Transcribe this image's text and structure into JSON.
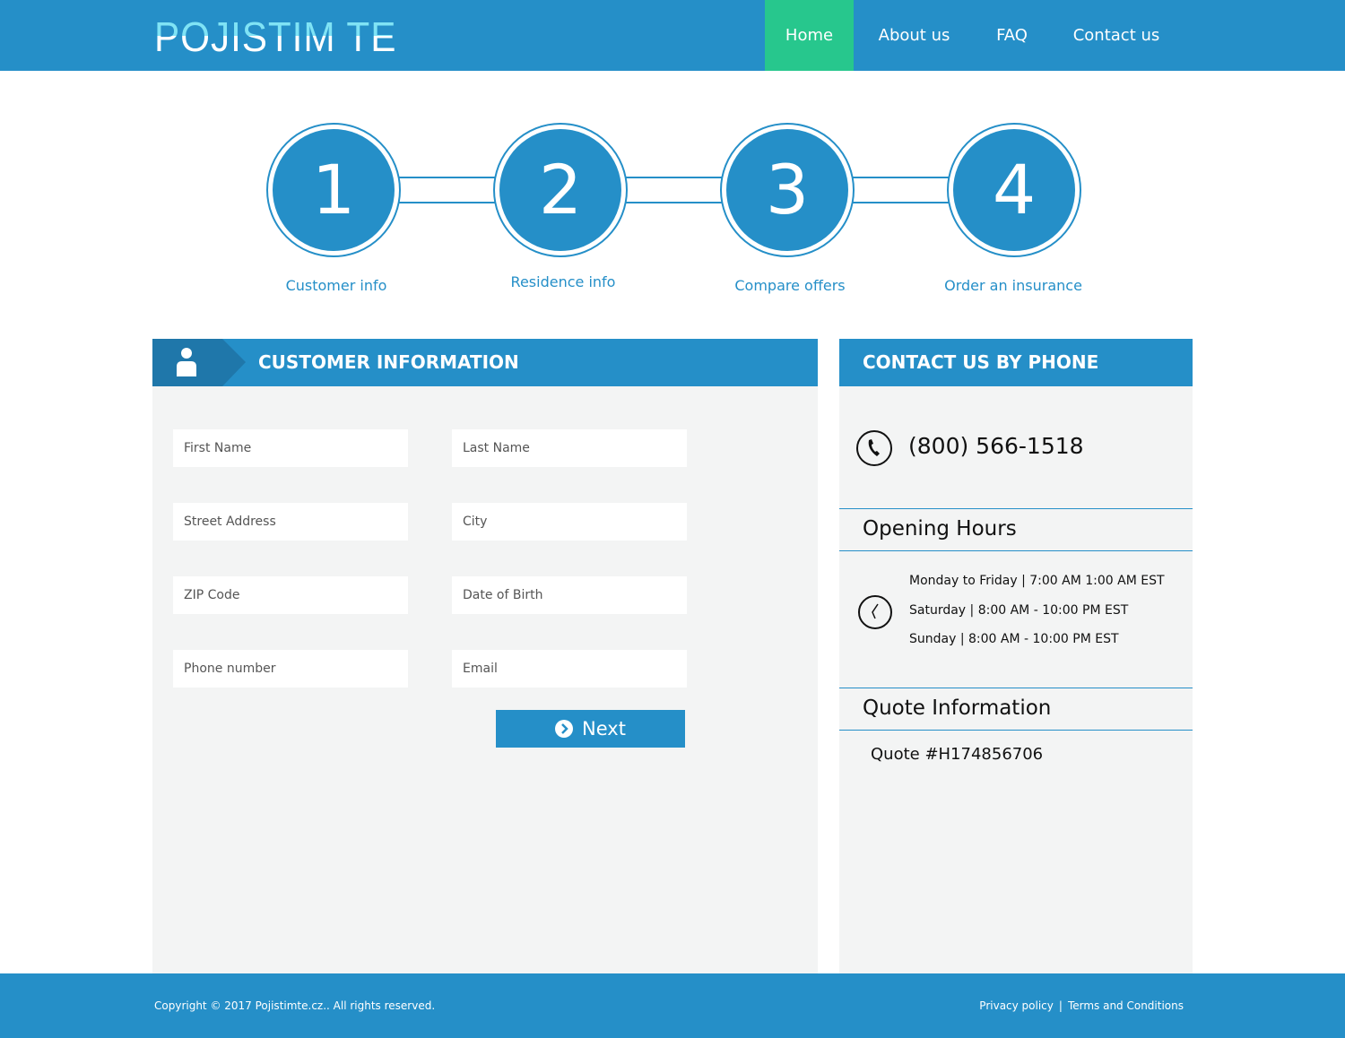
{
  "header": {
    "logo": "POJISTIM TE",
    "nav": [
      "Home",
      "About us",
      "FAQ",
      "Contact us"
    ]
  },
  "steps": [
    {
      "num": "1",
      "label": "Customer info"
    },
    {
      "num": "2",
      "label": "Residence info"
    },
    {
      "num": "3",
      "label": "Compare offers"
    },
    {
      "num": "4",
      "label": "Order an insurance"
    }
  ],
  "form": {
    "title": "CUSTOMER INFORMATION",
    "fields": [
      "First Name",
      "Last Name",
      "Street Address",
      "City",
      "ZIP Code",
      "Date of Birth",
      "Phone number",
      "Email"
    ],
    "next": "Next"
  },
  "contact": {
    "title": "CONTACT US BY PHONE",
    "phone": "(800) 566-1518",
    "hours_title": "Opening Hours",
    "hours": [
      "Monday to Friday | 7:00 AM 1:00 AM EST",
      "Saturday | 8:00 AM - 10:00 PM EST",
      "Sunday | 8:00 AM - 10:00 PM EST"
    ],
    "quote_title": "Quote Information",
    "quote": "Quote #H174856706"
  },
  "footer": {
    "copyright": "Copyright © 2017 Pojistimte.cz.. All rights reserved.",
    "privacy": "Privacy policy",
    "sep": "|",
    "terms": "Terms and Conditions"
  }
}
